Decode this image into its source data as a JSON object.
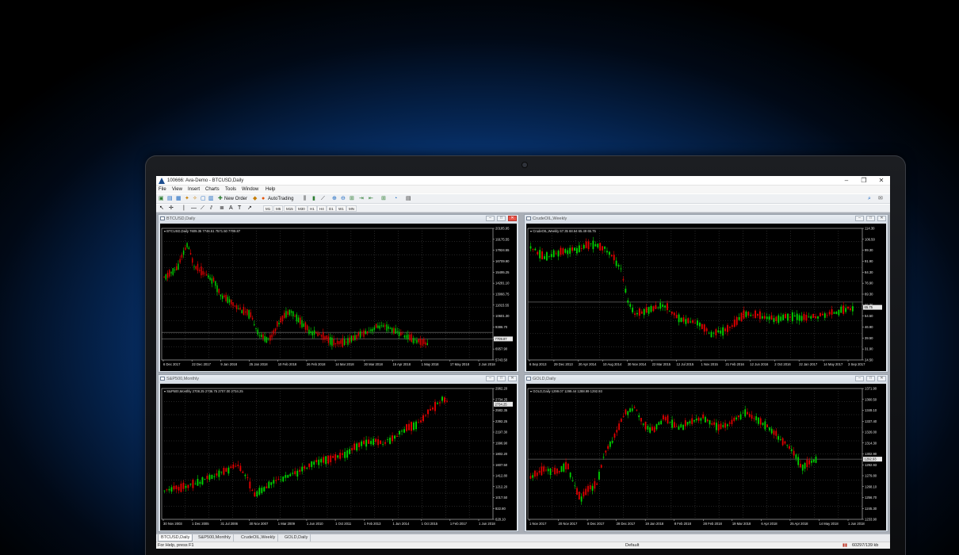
{
  "window": {
    "title": "100666: Ava-Demo - BTCUSD,Daily"
  },
  "menu": [
    "File",
    "View",
    "Insert",
    "Charts",
    "Tools",
    "Window",
    "Help"
  ],
  "toolbar": {
    "new_order": "New Order",
    "auto_trading": "AutoTrading",
    "timeframes": [
      "M1",
      "M5",
      "M15",
      "M30",
      "H1",
      "H4",
      "D1",
      "W1",
      "MN"
    ]
  },
  "charts": [
    {
      "title": "BTCUSD,Daily",
      "info": "BTCUSD,Daily  7609.35 7746.51 7571.50 7709.87",
      "y_labels": [
        "20185.95",
        "19175.55",
        "17924.55",
        "16709.90",
        "15495.25",
        "14281.10",
        "13066.75",
        "11815.55",
        "10601.30",
        "9386.70",
        "8172.30",
        "6957.90",
        "5743.50"
      ],
      "x_labels": [
        "6 Dec 2017",
        "22 Dec 2017",
        "9 Jan 2018",
        "25 Jan 2018",
        "10 Feb 2018",
        "26 Feb 2018",
        "14 Mar 2018",
        "30 Mar 2018",
        "15 Apr 2018",
        "1 May 2018",
        "17 May 2018",
        "2 Jun 2018"
      ],
      "price_tag": "7709.87"
    },
    {
      "title": "CrudeOIL,Weekly",
      "info": "CrudeOIL,Weekly  67.35 68.64 65.49 65.75",
      "y_labels": [
        "114.30",
        "106.50",
        "99.30",
        "91.90",
        "84.30",
        "76.90",
        "69.30",
        "65.75",
        "54.50",
        "46.90",
        "39.50",
        "31.90",
        "24.50"
      ],
      "x_labels": [
        "6 Sep 2013",
        "29 Dec 2013",
        "20 Apr 2014",
        "10 Aug 2014",
        "30 Nov 2014",
        "22 Mar 2015",
        "12 Jul 2015",
        "1 Nov 2015",
        "21 Feb 2016",
        "12 Jun 2016",
        "2 Oct 2016",
        "22 Jan 2017",
        "14 May 2017",
        "3 Sep 2017"
      ],
      "price_tag": "65.75"
    },
    {
      "title": "S&P500,Monthly",
      "info": "S&P500,Monthly  2708.25 2736.75 2707.00 2734.25",
      "y_labels": [
        "2962.20",
        "2734.25",
        "2582.35",
        "2392.25",
        "2197.30",
        "1996.90",
        "1802.20",
        "1607.50",
        "1412.80",
        "1212.20",
        "1017.50",
        "822.80",
        "628.10"
      ],
      "x_labels": [
        "30 Nov 2003",
        "1 Dec 2005",
        "31 Jul 2006",
        "30 Nov 2007",
        "1 Mar 2009",
        "1 Jun 2010",
        "1 Oct 2011",
        "1 Feb 2013",
        "1 Jun 2014",
        "1 Oct 2015",
        "1 Feb 2017",
        "1 Jun 2018"
      ],
      "price_tag": "2734.25"
    },
    {
      "title": "GOLD,Daily",
      "info": "GOLD,Daily  1299.07 1299.44 1288.99 1292.93",
      "y_labels": [
        "1371.90",
        "1360.50",
        "1349.10",
        "1337.40",
        "1326.00",
        "1314.30",
        "1302.90",
        "1292.93",
        "1279.80",
        "1268.10",
        "1256.70",
        "1245.30",
        "1233.90"
      ],
      "x_labels": [
        "1 Nov 2017",
        "20 Nov 2017",
        "8 Dec 2017",
        "28 Dec 2017",
        "19 Jan 2018",
        "8 Feb 2018",
        "28 Feb 2018",
        "19 Mar 2018",
        "6 Apr 2018",
        "25 Apr 2018",
        "14 May 2018",
        "1 Jun 2018"
      ],
      "price_tag": "1292.93"
    }
  ],
  "tabs": [
    "BTCUSD,Daily",
    "S&P500,Monthly",
    "CrudeOIL,Weekly",
    "GOLD,Daily"
  ],
  "status": {
    "help": "For Help, press F1",
    "profile": "Default",
    "traffic": "60297/139 kb"
  },
  "colors": {
    "bull_candle": "#00d000",
    "bear_candle": "#e00000",
    "chart_bg": "#000000",
    "grid": "#4a4a4a",
    "background_glow": "#1c7ff0"
  }
}
